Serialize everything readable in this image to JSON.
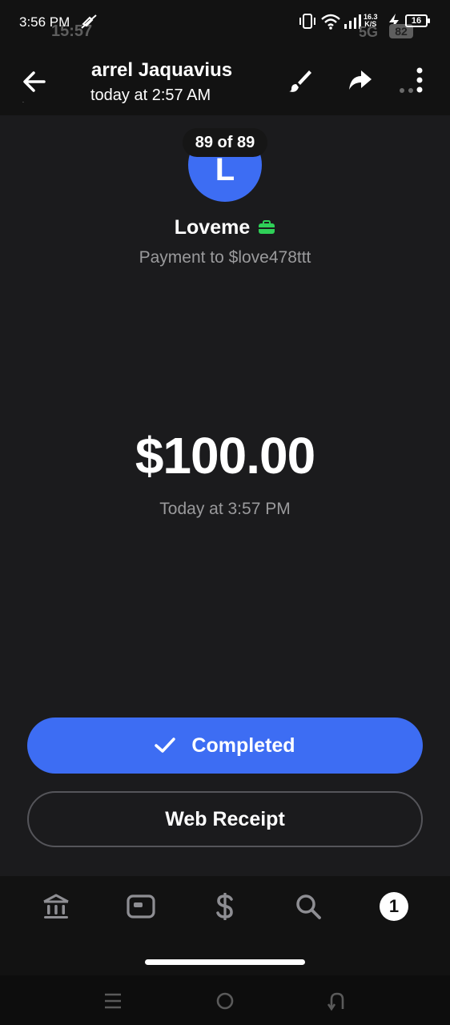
{
  "status_bar": {
    "time": "3:56 PM",
    "ghost_time": "15:57",
    "network_speed_value": "16.3",
    "network_speed_unit": "K/S",
    "ghost_network": "5G",
    "ghost_battery": "82",
    "battery": "16"
  },
  "header": {
    "name": "arrel Jaquavius",
    "subtitle": "today at 2:57 AM"
  },
  "counter": "89 of 89",
  "avatar_initial": "L",
  "payee": {
    "name": "Loveme",
    "subtitle": "Payment to $love478ttt"
  },
  "amount": "$100.00",
  "amount_time": "Today at 3:57 PM",
  "buttons": {
    "completed": "Completed",
    "web_receipt": "Web Receipt"
  },
  "tabs": [
    {
      "icon": "bank-icon"
    },
    {
      "icon": "card-icon"
    },
    {
      "icon": "dollar-icon"
    },
    {
      "icon": "search-icon"
    },
    {
      "icon": "activity-badge-icon",
      "badge": "1"
    }
  ],
  "colors": {
    "accent": "#3d6df3",
    "background": "#1b1b1d",
    "business_badge": "#2fd058"
  }
}
